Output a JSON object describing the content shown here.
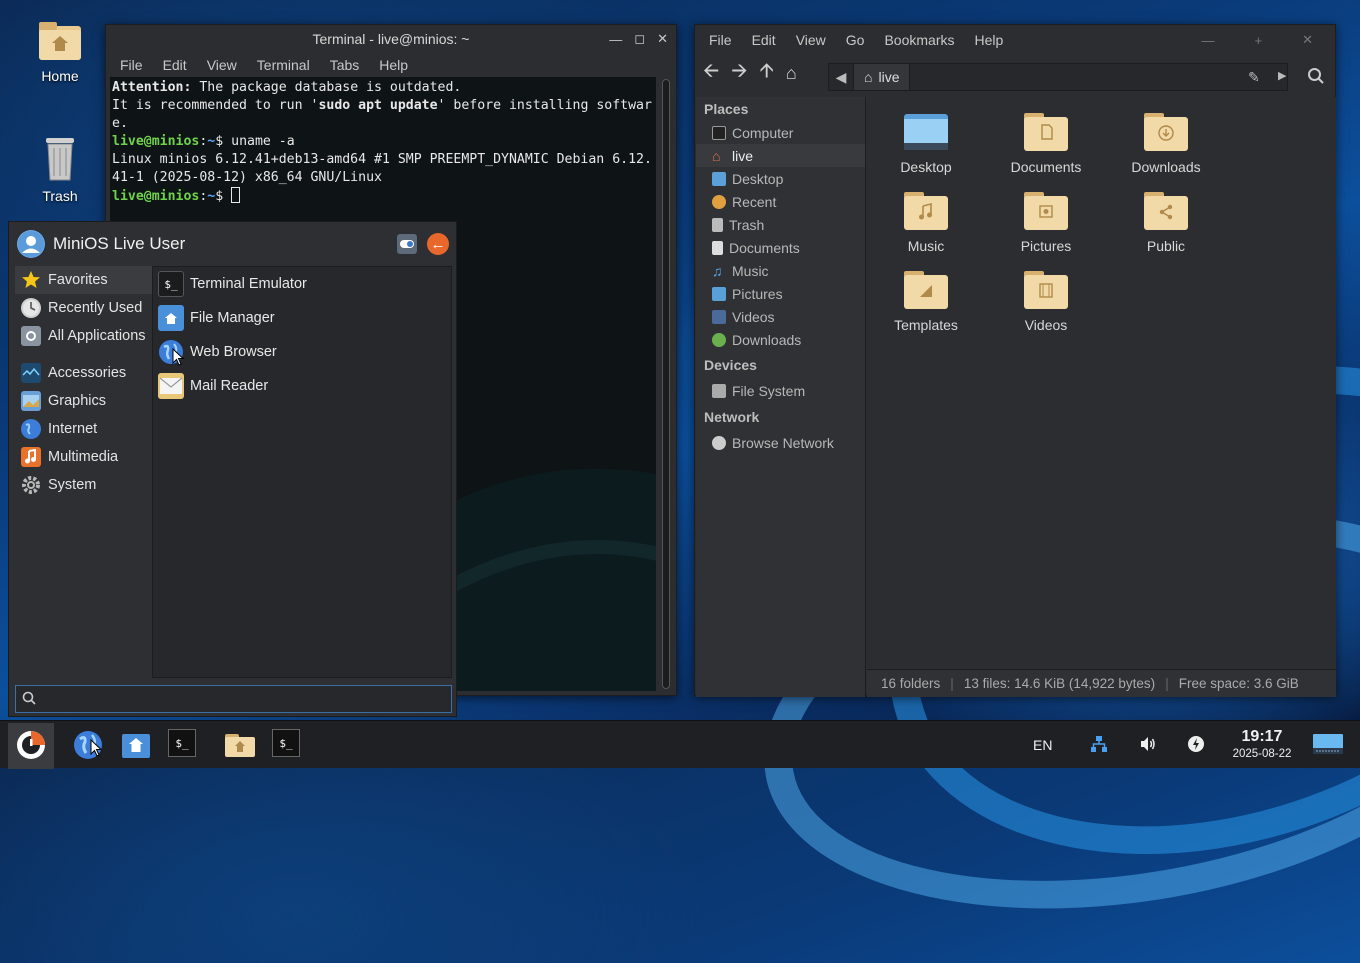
{
  "desktop": {
    "icons": [
      {
        "label": "Home",
        "icon": "home-folder-icon"
      },
      {
        "label": "Trash",
        "icon": "trash-icon"
      }
    ]
  },
  "terminal": {
    "title": "Terminal - live@minios: ~",
    "menu": [
      "File",
      "Edit",
      "View",
      "Terminal",
      "Tabs",
      "Help"
    ],
    "lines": {
      "attention_label": "Attention:",
      "attention_text": " The package database is outdated.",
      "recommend_pre": "It is recommended to run '",
      "recommend_cmd": "sudo apt update",
      "recommend_post": "' before installing softwar",
      "recommend_wrap": "e.",
      "prompt_user": "live@minios",
      "prompt_sep": ":",
      "prompt_dir": "~",
      "prompt_end": "$ ",
      "cmd1": "uname -a",
      "out1": "Linux minios 6.12.41+deb13-amd64 #1 SMP PREEMPT_DYNAMIC Debian 6.12.",
      "out2": "41-1 (2025-08-12) x86_64 GNU/Linux"
    }
  },
  "menu": {
    "user": "MiniOS Live User",
    "categories": [
      {
        "label": "Favorites",
        "icon": "star-icon",
        "color": "#f5c518"
      },
      {
        "label": "Recently Used",
        "icon": "clock-icon",
        "color": "#c0c0c0"
      },
      {
        "label": "All Applications",
        "icon": "apps-icon",
        "color": "#9aa4b0"
      },
      {
        "label": "Accessories",
        "icon": "accessories-icon",
        "color": "#2b5f8f"
      },
      {
        "label": "Graphics",
        "icon": "graphics-icon",
        "color": "#6aa0d8"
      },
      {
        "label": "Internet",
        "icon": "globe-icon",
        "color": "#3b7dd8"
      },
      {
        "label": "Multimedia",
        "icon": "music-icon",
        "color": "#e8712c"
      },
      {
        "label": "System",
        "icon": "gear-icon",
        "color": "#b0b0b0"
      }
    ],
    "apps": [
      {
        "label": "Terminal Emulator",
        "icon": "terminal-icon"
      },
      {
        "label": "File Manager",
        "icon": "file-manager-icon"
      },
      {
        "label": "Web Browser",
        "icon": "web-browser-icon"
      },
      {
        "label": "Mail Reader",
        "icon": "mail-icon"
      }
    ],
    "search_placeholder": ""
  },
  "filemanager": {
    "menu": [
      "File",
      "Edit",
      "View",
      "Go",
      "Bookmarks",
      "Help"
    ],
    "path": "live",
    "sections": {
      "places": "Places",
      "devices": "Devices",
      "network": "Network"
    },
    "places": [
      {
        "label": "Computer",
        "icon": "computer-icon"
      },
      {
        "label": "live",
        "icon": "home-icon"
      },
      {
        "label": "Desktop",
        "icon": "desktop-icon"
      },
      {
        "label": "Recent",
        "icon": "recent-icon"
      },
      {
        "label": "Trash",
        "icon": "trash-icon"
      },
      {
        "label": "Documents",
        "icon": "documents-icon"
      },
      {
        "label": "Music",
        "icon": "music-icon"
      },
      {
        "label": "Pictures",
        "icon": "pictures-icon"
      },
      {
        "label": "Videos",
        "icon": "videos-icon"
      },
      {
        "label": "Downloads",
        "icon": "downloads-icon"
      }
    ],
    "devices": [
      {
        "label": "File System",
        "icon": "drive-icon"
      }
    ],
    "network": [
      {
        "label": "Browse Network",
        "icon": "cloud-icon"
      }
    ],
    "folders": [
      "Desktop",
      "Documents",
      "Downloads",
      "Music",
      "Pictures",
      "Public",
      "Templates",
      "Videos"
    ],
    "status": {
      "folders": "16 folders",
      "files": "13 files: 14.6 KiB (14,922 bytes)",
      "free": "Free space: 3.6 GiB"
    }
  },
  "panel": {
    "lang": "EN",
    "time": "19:17",
    "date": "2025-08-22"
  }
}
